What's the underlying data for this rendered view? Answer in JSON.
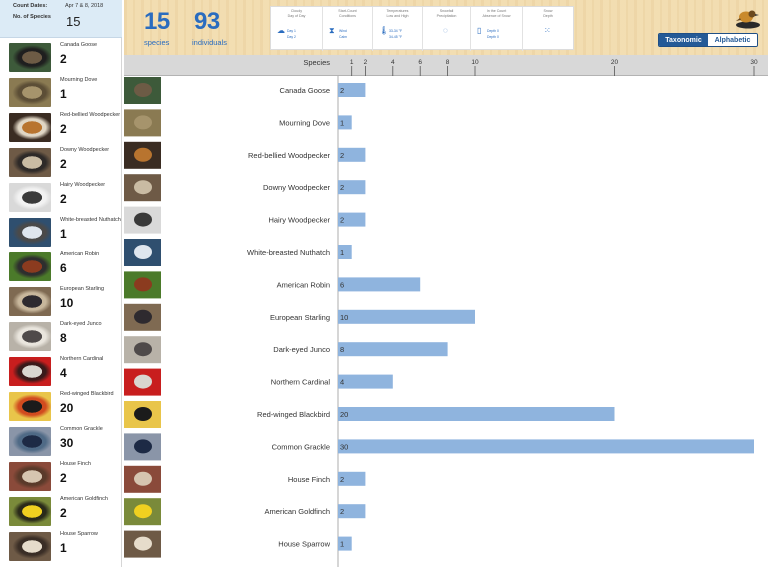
{
  "colors": {
    "accent": "#2a6cbf",
    "bar": "#8fb4de",
    "header_wood": "#f2dcae",
    "count_panel": "#dcebf6",
    "axis_bar": "#d8d8d8",
    "toggle_active": "#245a97"
  },
  "count_panel": {
    "dates_label": "Count Dates:",
    "dates_value": "Apr 7 & 8, 2018",
    "species_label": "No. of Species",
    "species_value": "15"
  },
  "header": {
    "species_count": "15",
    "species_label": "species",
    "individuals_count": "93",
    "individuals_label": "individuals",
    "conditions": [
      {
        "title": "Cloudy\nDay of Day",
        "icon": "cloud-icon",
        "sub": [
          "Day 1",
          "Day 2"
        ]
      },
      {
        "title": "Start-Count\nConditions",
        "icon": "hourglass-icon",
        "sub": [
          "Wind",
          "Calm"
        ]
      },
      {
        "title": "Temperatures\nLow and High",
        "icon": "thermometer-icon",
        "sub": [
          "33-34 °F",
          "34-45 °F"
        ]
      },
      {
        "title": "Snowfall\nPrecipitation",
        "icon": "precipitation-icon",
        "sub": []
      },
      {
        "title": "In the Count\nAbsence of Snow",
        "icon": "snow-depth-icon",
        "sub": [
          "Depth 0",
          "Depth 0"
        ]
      },
      {
        "title": "Snow\nDepth",
        "icon": "snowflake-icon",
        "sub": []
      }
    ],
    "sort_options": [
      "Taxonomic",
      "Alphabetic"
    ],
    "sort_selected": "Taxonomic"
  },
  "chart_data": {
    "type": "bar",
    "orientation": "horizontal",
    "xlabel": "",
    "ylabel": "Species",
    "x_ticks": [
      1,
      2,
      4,
      6,
      8,
      10,
      20,
      30
    ],
    "x_scale": "nonlinear",
    "xlim": [
      0,
      30
    ],
    "categories": [
      "Canada Goose",
      "Mourning Dove",
      "Red-bellied Woodpecker",
      "Downy Woodpecker",
      "Hairy Woodpecker",
      "White-breasted Nuthatch",
      "American Robin",
      "European Starling",
      "Dark-eyed Junco",
      "Northern Cardinal",
      "Red-winged Blackbird",
      "Common Grackle",
      "House Finch",
      "American Goldfinch",
      "House Sparrow"
    ],
    "values": [
      2,
      1,
      2,
      2,
      2,
      1,
      6,
      10,
      8,
      4,
      20,
      30,
      2,
      2,
      1
    ],
    "grid": false,
    "legend": "none"
  },
  "species_list": [
    {
      "name": "Canada Goose",
      "count": "2"
    },
    {
      "name": "Mourning Dove",
      "count": "1"
    },
    {
      "name": "Red-bellied Woodpecker",
      "count": "2"
    },
    {
      "name": "Downy Woodpecker",
      "count": "2"
    },
    {
      "name": "Hairy Woodpecker",
      "count": "2"
    },
    {
      "name": "White-breasted Nuthatch",
      "count": "1"
    },
    {
      "name": "American Robin",
      "count": "6"
    },
    {
      "name": "European Starling",
      "count": "10"
    },
    {
      "name": "Dark-eyed Junco",
      "count": "8"
    },
    {
      "name": "Northern Cardinal",
      "count": "4"
    },
    {
      "name": "Red-winged Blackbird",
      "count": "20"
    },
    {
      "name": "Common Grackle",
      "count": "30"
    },
    {
      "name": "House Finch",
      "count": "2"
    },
    {
      "name": "American Goldfinch",
      "count": "2"
    },
    {
      "name": "House Sparrow",
      "count": "1"
    }
  ],
  "photo_palettes": [
    [
      "#3d5a3a",
      "#6d5b45",
      "#1f1f1f"
    ],
    [
      "#8a7a52",
      "#a6946c",
      "#5c4e36"
    ],
    [
      "#3a2c22",
      "#b8742f",
      "#e0d6c4"
    ],
    [
      "#6e5a46",
      "#c9bba3",
      "#2e2a28"
    ],
    [
      "#d9d9d9",
      "#3a3a3a",
      "#f2f2f2"
    ],
    [
      "#2f4f6f",
      "#dfe6ee",
      "#4a4a4a"
    ],
    [
      "#4b7a2a",
      "#8b3b1f",
      "#2e2e2e"
    ],
    [
      "#7f6a52",
      "#2e2a2f",
      "#c8b79c"
    ],
    [
      "#b8b2a8",
      "#4f4a4a",
      "#e9e5dd"
    ],
    [
      "#c81e1e",
      "#d9d6d0",
      "#3a1a1a"
    ],
    [
      "#e9c54a",
      "#1b1b1b",
      "#d14b1f"
    ],
    [
      "#8a95a8",
      "#1d2a45",
      "#4f6a86"
    ],
    [
      "#8a4a3a",
      "#d6c5b0",
      "#5a3a2a"
    ],
    [
      "#7a8a3a",
      "#f0d020",
      "#2a2a1a"
    ],
    [
      "#6e5a46",
      "#e6dccb",
      "#3a2e26"
    ]
  ]
}
